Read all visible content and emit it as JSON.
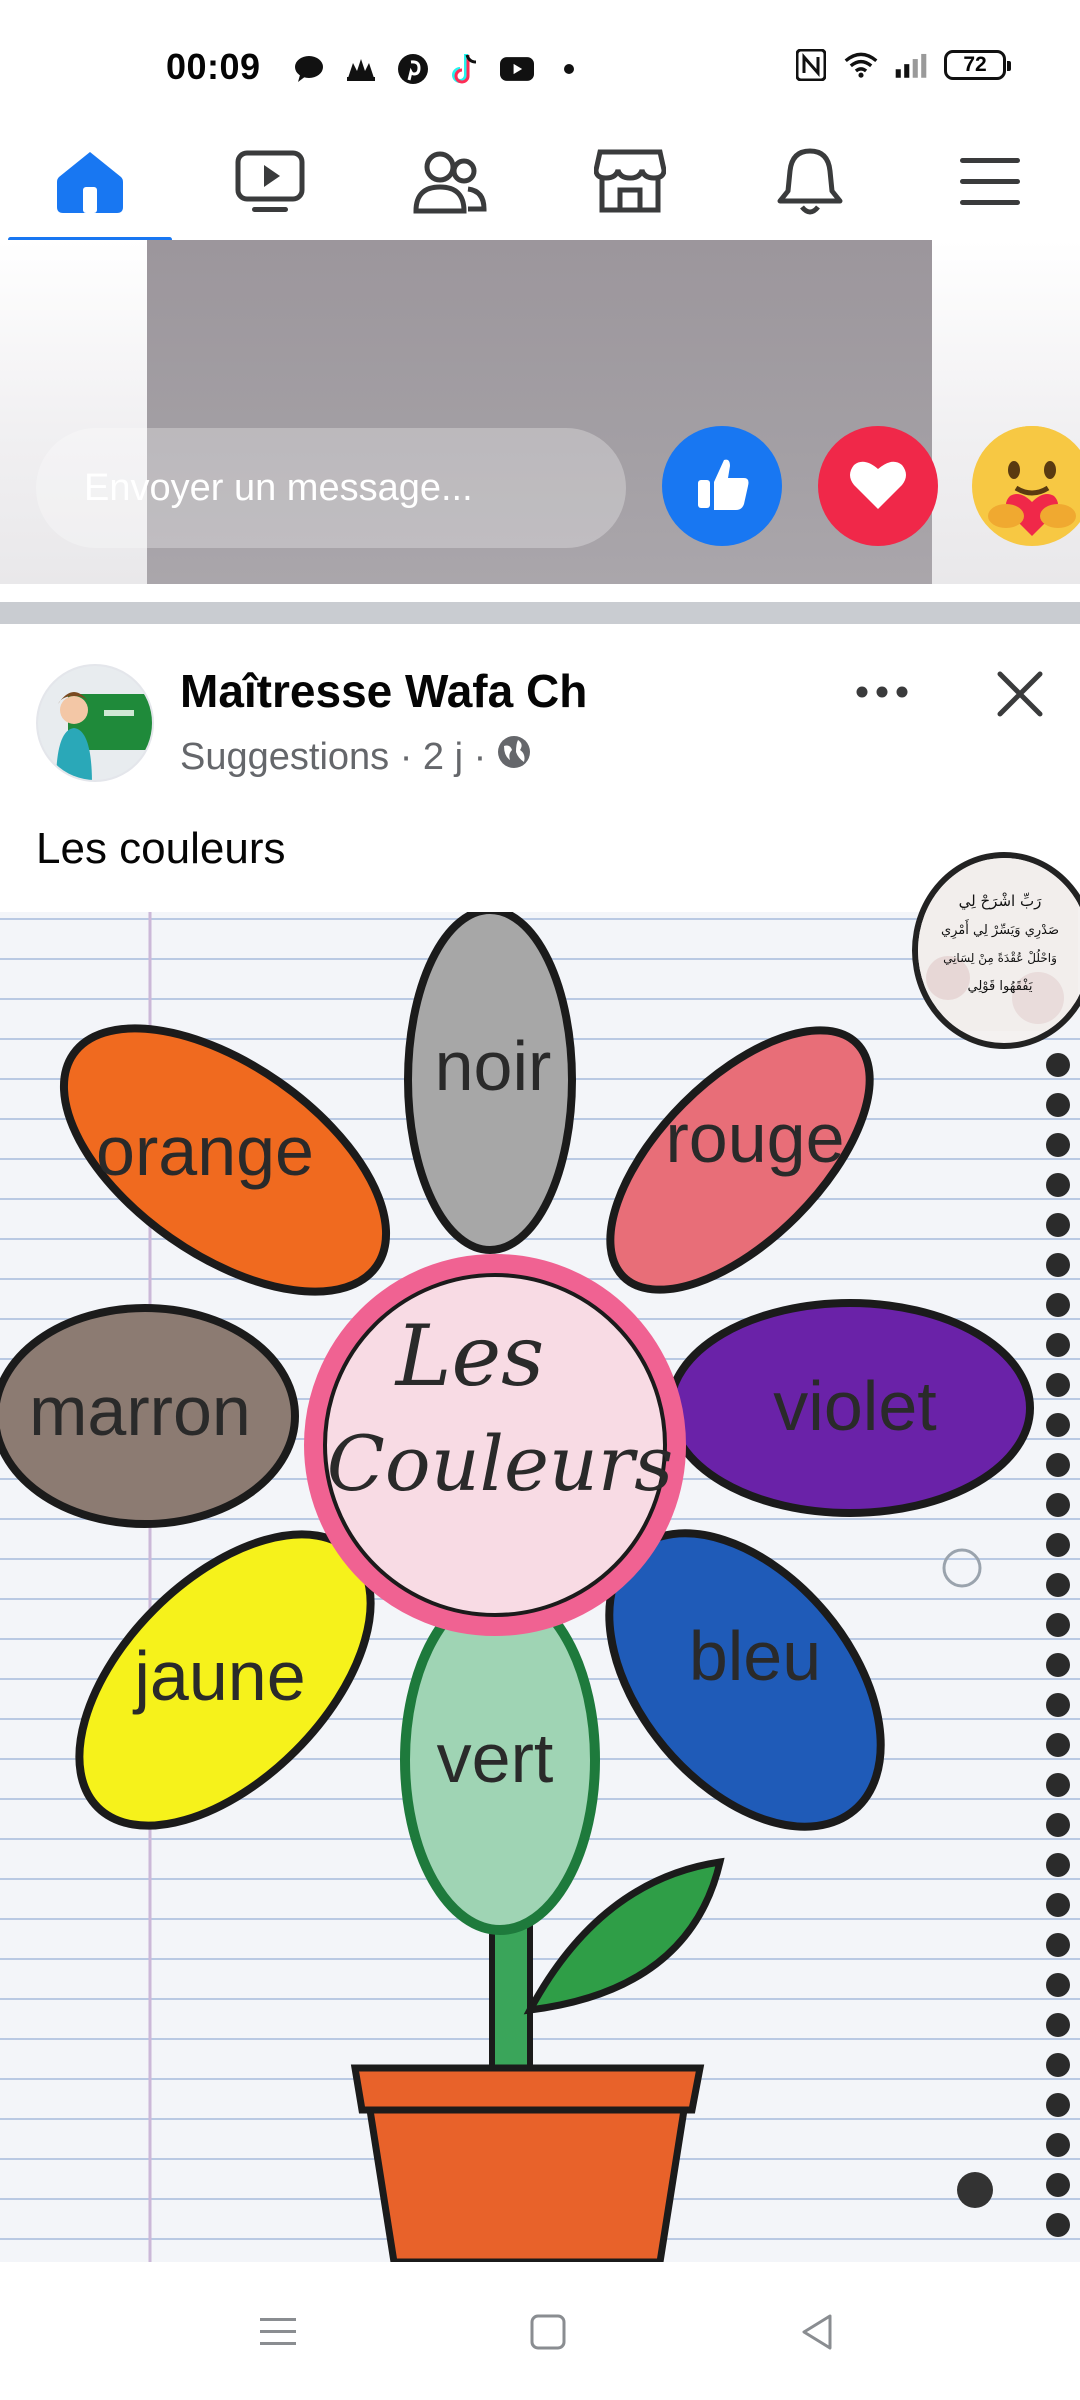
{
  "status_bar": {
    "time": "00:09",
    "app_icons": [
      "messages-icon",
      "game-icon",
      "pinterest-icon",
      "tiktok-icon",
      "youtube-icon",
      "dot-icon"
    ],
    "right_icons": [
      "nfc-icon",
      "wifi-icon",
      "signal-icon"
    ],
    "battery": "72"
  },
  "nav": {
    "tabs": [
      "home-icon",
      "video-icon",
      "friends-icon",
      "marketplace-icon",
      "notifications-icon",
      "menu-icon"
    ],
    "active_index": 0,
    "accent": "#1877f2"
  },
  "story": {
    "message_placeholder": "Envoyer un message...",
    "reactions": [
      "like-icon",
      "love-icon",
      "care-icon"
    ]
  },
  "post": {
    "author": "Maîtresse Wafa Ch",
    "meta_text": "Suggestions · 2 j ·",
    "privacy_icon": "globe-icon",
    "caption": "Les couleurs"
  },
  "image": {
    "center_line1": "Les",
    "center_line2": "Couleurs",
    "petals": [
      "noir",
      "rouge",
      "orange",
      "violet",
      "marron",
      "bleu",
      "jaune",
      "vert"
    ],
    "badge_lines": [
      "رَبِّ اشْرَحْ لِي",
      "صَدْرِي وَيَسِّرْ لِي أَمْرِي",
      "وَاحْلُلْ عُقْدَةً مِنْ لِسَانِي",
      "يَفْقَهُوا قَوْلِي"
    ]
  },
  "system_nav": [
    "recents-icon",
    "home-square-icon",
    "back-icon"
  ]
}
